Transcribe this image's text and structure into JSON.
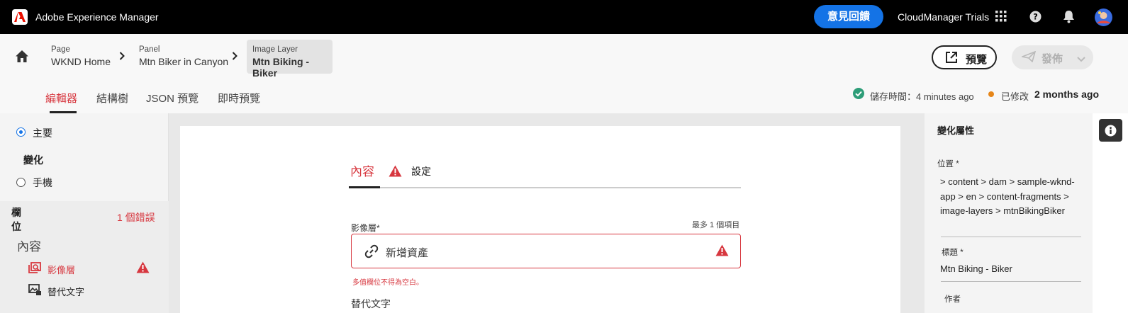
{
  "topbar": {
    "app_title": "Adobe Experience Manager",
    "feedback_label": "意見回饋",
    "org_name": "CloudManager Trials",
    "icons": [
      "adobe-logo-icon",
      "apps-grid-icon",
      "help-icon",
      "bell-icon",
      "avatar"
    ]
  },
  "breadcrumb": [
    {
      "type": "Page",
      "name": "WKND Home"
    },
    {
      "type": "Panel",
      "name": "Mtn Biker in Canyon"
    },
    {
      "type": "Image Layer",
      "name": "Mtn Biking - Biker"
    }
  ],
  "actions": {
    "preview_label": "預覽",
    "publish_label": "發佈"
  },
  "tabs": [
    "編輯器",
    "結構樹",
    "JSON 預覽",
    "即時預覽"
  ],
  "status": {
    "saved_text": "儲存時間：4 minutes ago",
    "modified_label": "已修改",
    "modified_value": "2 months ago",
    "colors": {
      "saved": "#2d9d78",
      "modified": "#e68619"
    }
  },
  "left_panel": {
    "primary_label": "主要",
    "variations_label": "變化",
    "mobile_label": "手機",
    "fields_label": "欄位",
    "error_count": "1 個錯誤",
    "content_label": "內容",
    "fields": [
      {
        "label": "影像層",
        "error": true
      },
      {
        "label": "替代文字",
        "error": false
      }
    ]
  },
  "editor": {
    "tab_content": "內容",
    "tab_settings": "設定",
    "field_label": "影像層*",
    "max_items": "最多 1 個項目",
    "add_asset": "新增資產",
    "error_message": "多值欄位不得為空白。",
    "alt_text_label": "替代文字"
  },
  "right_panel": {
    "title": "變化屬性",
    "location_label": "位置 *",
    "location_value": " > content > dam > sample-wknd-app > en > content-fragments > image-layers > mtnBikingBiker",
    "title_label": "標題 *",
    "title_value": "Mtn Biking - Biker",
    "author_label": "作者"
  },
  "accent": "#d7373f",
  "brand_blue": "#1473e6"
}
